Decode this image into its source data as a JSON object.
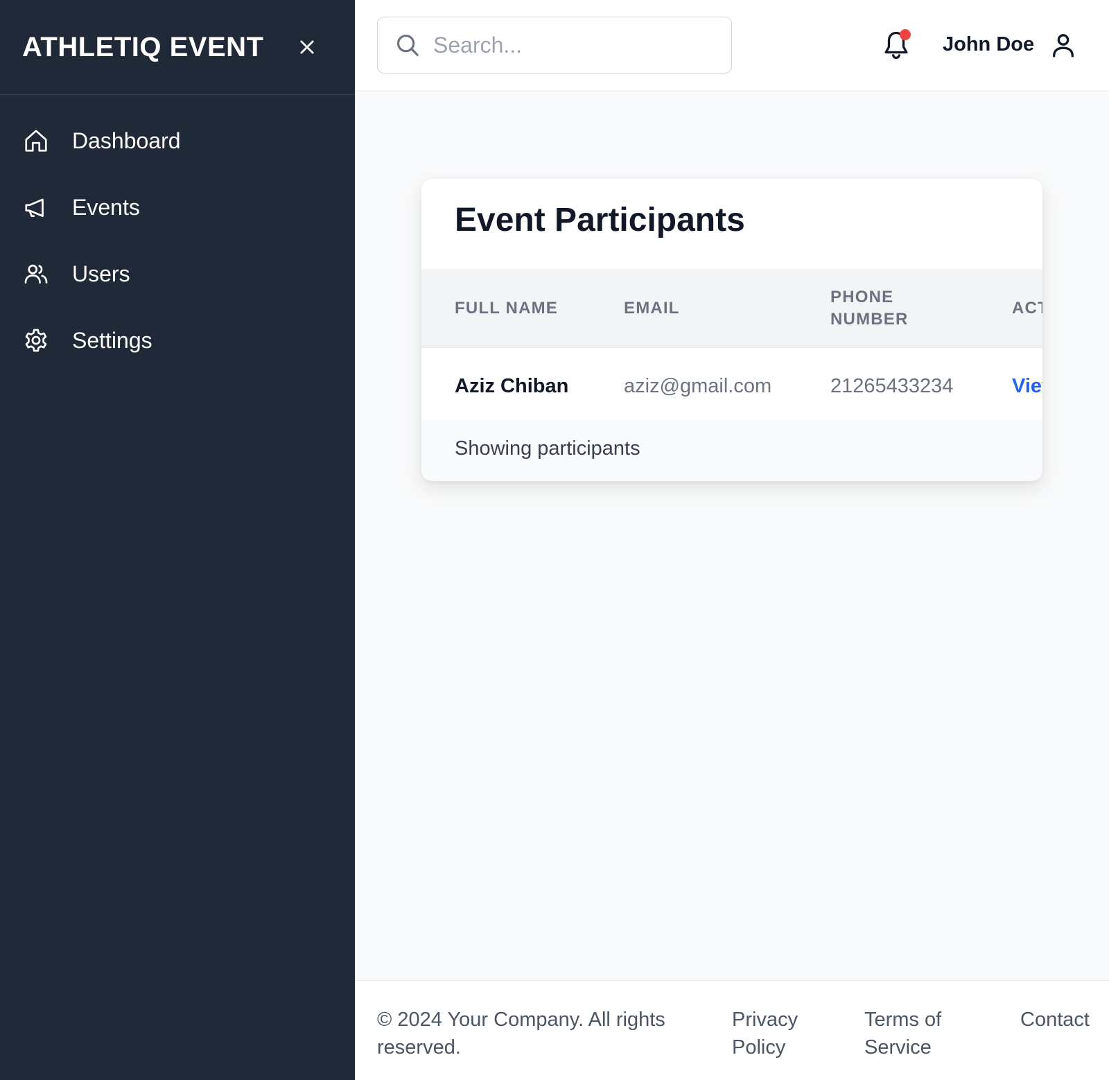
{
  "sidebar": {
    "brand": "ATHLETIQ EVENT",
    "items": [
      {
        "label": "Dashboard",
        "icon": "home-icon"
      },
      {
        "label": "Events",
        "icon": "megaphone-icon"
      },
      {
        "label": "Users",
        "icon": "users-icon"
      },
      {
        "label": "Settings",
        "icon": "gear-icon"
      }
    ]
  },
  "header": {
    "search_placeholder": "Search...",
    "user_name": "John Doe"
  },
  "participants": {
    "title": "Event Participants",
    "columns": [
      "FULL NAME",
      "EMAIL",
      "PHONE NUMBER",
      "ACT"
    ],
    "rows": [
      {
        "full_name": "Aziz Chiban",
        "email": "aziz@gmail.com",
        "phone": "21265433234",
        "action": "Viev"
      }
    ],
    "footer_text": "Showing participants"
  },
  "footer": {
    "copyright": "© 2024 Your Company. All rights reserved.",
    "links": [
      "Privacy Policy",
      "Terms of Service",
      "Contact"
    ]
  },
  "colors": {
    "sidebar_bg": "#1f2937",
    "accent_link": "#2563eb",
    "notification_dot": "#ef4444"
  }
}
